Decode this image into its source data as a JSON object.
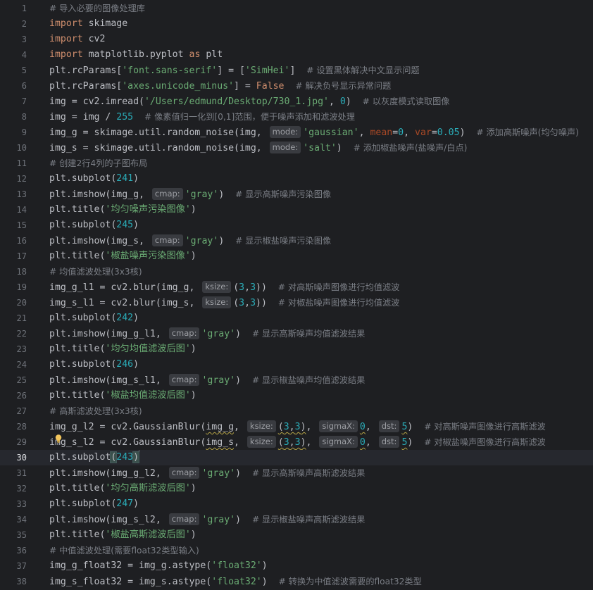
{
  "editor": {
    "current_line": 30,
    "lines": [
      {
        "n": "1",
        "html": "<span class='cmt'># 导入必要的图像处理库</span>"
      },
      {
        "n": "2",
        "html": "<span class='kw'>import</span> skimage"
      },
      {
        "n": "3",
        "html": "<span class='kw'>import</span> cv2"
      },
      {
        "n": "4",
        "html": "<span class='kw'>import</span> matplotlib.pyplot <span class='kw'>as</span> plt"
      },
      {
        "n": "5",
        "html": "plt.rcParams[<span class='str'>'font.sans-serif'</span>] = [<span class='str'>'SimHei'</span>]  <span class='cmt'># 设置黑体解决中文显示问题</span>"
      },
      {
        "n": "6",
        "html": "plt.rcParams[<span class='str'>'axes.unicode_minus'</span>] = <span class='kw'>False</span>  <span class='cmt'># 解决负号显示异常问题</span>"
      },
      {
        "n": "7",
        "html": "img = cv2.imread(<span class='str'>'/Users/edmund/Desktop/730_1.jpg'</span>, <span class='num'>0</span>)  <span class='cmt'># 以灰度模式读取图像</span>"
      },
      {
        "n": "8",
        "html": "img = img / <span class='num'>255</span>  <span class='cmt'># 像素值归一化到[0,1]范围，便于噪声添加和滤波处理</span>"
      },
      {
        "n": "9",
        "html": "img_g = skimage.util.random_noise(img, <span class='hint'>mode:</span><span class='str'>'gaussian'</span>, <span class='param'>mean</span>=<span class='num'>0</span>, <span class='param'>var</span>=<span class='num'>0.05</span>)  <span class='cmt'># 添加高斯噪声(均匀噪声)</span>"
      },
      {
        "n": "10",
        "html": "img_s = skimage.util.random_noise(img, <span class='hint'>mode:</span><span class='str'>'salt'</span>)  <span class='cmt'># 添加椒盐噪声(盐噪声/白点)</span>"
      },
      {
        "n": "11",
        "html": "<span class='cmt'># 创建2行4列的子图布局</span>"
      },
      {
        "n": "12",
        "html": "plt.subplot(<span class='num'>241</span>)"
      },
      {
        "n": "13",
        "html": "plt.imshow(img_g, <span class='hint'>cmap:</span><span class='str'>'gray'</span>)  <span class='cmt'># 显示高斯噪声污染图像</span>"
      },
      {
        "n": "14",
        "html": "plt.title(<span class='str'>'均匀噪声污染图像'</span>)"
      },
      {
        "n": "15",
        "html": "plt.subplot(<span class='num'>245</span>)"
      },
      {
        "n": "16",
        "html": "plt.imshow(img_s, <span class='hint'>cmap:</span><span class='str'>'gray'</span>)  <span class='cmt'># 显示椒盐噪声污染图像</span>"
      },
      {
        "n": "17",
        "html": "plt.title(<span class='str'>'椒盐噪声污染图像'</span>)"
      },
      {
        "n": "18",
        "html": "<span class='cmt'># 均值滤波处理(3x3核)</span>"
      },
      {
        "n": "19",
        "html": "img_g_l1 = cv2.blur(img_g, <span class='hint'>ksize:</span>(<span class='num'>3</span>,<span class='num'>3</span>))  <span class='cmt'># 对高斯噪声图像进行均值滤波</span>"
      },
      {
        "n": "20",
        "html": "img_s_l1 = cv2.blur(img_s, <span class='hint'>ksize:</span>(<span class='num'>3</span>,<span class='num'>3</span>))  <span class='cmt'># 对椒盐噪声图像进行均值滤波</span>"
      },
      {
        "n": "21",
        "html": "plt.subplot(<span class='num'>242</span>)"
      },
      {
        "n": "22",
        "html": "plt.imshow(img_g_l1, <span class='hint'>cmap:</span><span class='str'>'gray'</span>)  <span class='cmt'># 显示高斯噪声均值滤波结果</span>"
      },
      {
        "n": "23",
        "html": "plt.title(<span class='str'>'均匀均值滤波后图'</span>)"
      },
      {
        "n": "24",
        "html": "plt.subplot(<span class='num'>246</span>)"
      },
      {
        "n": "25",
        "html": "plt.imshow(img_s_l1, <span class='hint'>cmap:</span><span class='str'>'gray'</span>)  <span class='cmt'># 显示椒盐噪声均值滤波结果</span>"
      },
      {
        "n": "26",
        "html": "plt.title(<span class='str'>'椒盐均值滤波后图'</span>)"
      },
      {
        "n": "27",
        "html": "<span class='cmt'># 高斯滤波处理(3x3核)</span>"
      },
      {
        "n": "28",
        "html": "img_g_l2 = cv2.GaussianBlur(<span class='wavy'>img_g</span>, <span class='hint'>ksize:</span><span class='wavy'>(<span class='num'>3</span>,<span class='num'>3</span>)</span>, <span class='hint'>sigmaX:</span><span class='num wavy'>0</span>, <span class='hint'>dst:</span><span class='num wavy'>5</span>)  <span class='cmt'># 对高斯噪声图像进行高斯滤波</span>"
      },
      {
        "n": "29",
        "html": "img_s_l2 = cv2.GaussianBlur(<span class='wavy'>img_s</span>, <span class='hint'>ksize:</span><span class='wavy'>(<span class='num'>3</span>,<span class='num'>3</span>)</span>, <span class='hint'>sigmaX:</span><span class='num wavy'>0</span>, <span class='hint'>dst:</span><span class='num wavy'>5</span>)  <span class='cmt'># 对椒盐噪声图像进行高斯滤波</span>"
      },
      {
        "n": "30",
        "html": "plt.subplot<span class='bracket-match'>(</span><span class='num'>243</span><span class='bracket-match'>)</span><span class='cursor'></span>"
      },
      {
        "n": "31",
        "html": "plt.imshow(img_g_l2, <span class='hint'>cmap:</span><span class='str'>'gray'</span>)  <span class='cmt'># 显示高斯噪声高斯滤波结果</span>"
      },
      {
        "n": "32",
        "html": "plt.title(<span class='str'>'均匀高斯滤波后图'</span>)"
      },
      {
        "n": "33",
        "html": "plt.subplot(<span class='num'>247</span>)"
      },
      {
        "n": "34",
        "html": "plt.imshow(img_s_l2, <span class='hint'>cmap:</span><span class='str'>'gray'</span>)  <span class='cmt'># 显示椒盐噪声高斯滤波结果</span>"
      },
      {
        "n": "35",
        "html": "plt.title(<span class='str'>'椒盐高斯滤波后图'</span>)"
      },
      {
        "n": "36",
        "html": "<span class='cmt'># 中值滤波处理(需要float32类型输入)</span>"
      },
      {
        "n": "37",
        "html": "img_g_float32 = img_g.astype(<span class='str'>'float32'</span>)"
      },
      {
        "n": "38",
        "html": "img_s_float32 = img_s.astype(<span class='str'>'float32'</span>)  <span class='cmt'># 转换为中值滤波需要的float32类型</span>"
      }
    ]
  },
  "colors": {
    "background": "#1e1f22",
    "current_line": "#26282e",
    "keyword": "#cf8e6d",
    "string": "#6aab73",
    "number": "#2aacb8",
    "comment": "#7a7e85",
    "gutter": "#6f737a"
  },
  "icons": {
    "intention": "lightbulb-icon"
  }
}
